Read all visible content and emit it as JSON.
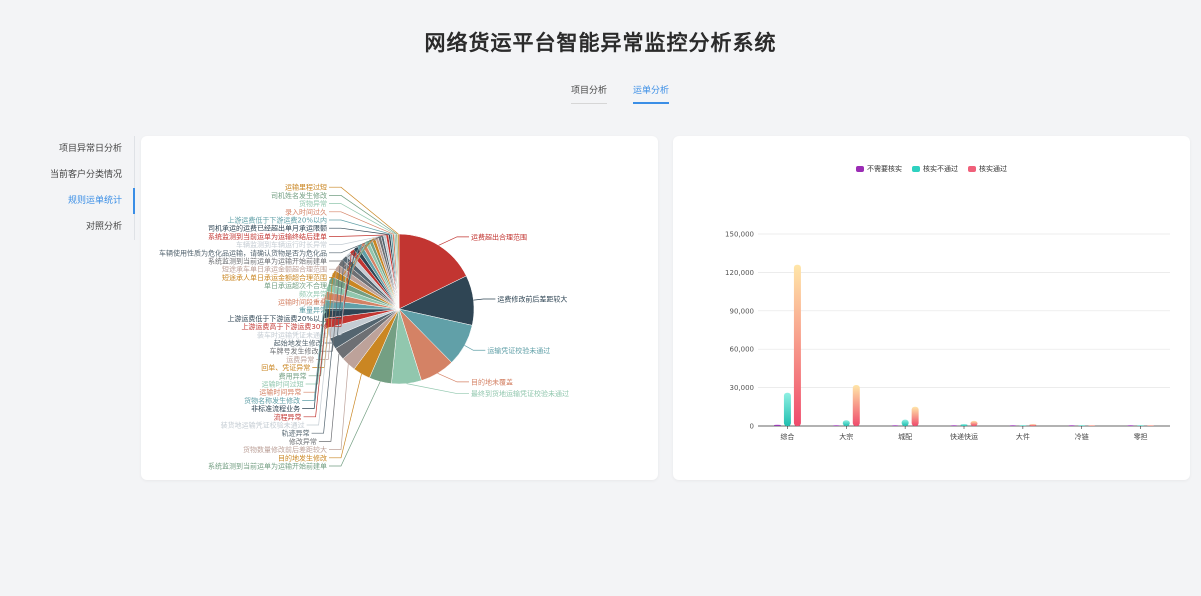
{
  "header": {
    "title": "网络货运平台智能异常监控分析系统"
  },
  "tabs": [
    {
      "label": "项目分析",
      "active": false
    },
    {
      "label": "运单分析",
      "active": true
    }
  ],
  "sidebar": {
    "items": [
      {
        "label": "项目异常日分析",
        "active": false
      },
      {
        "label": "当前客户分类情况",
        "active": false
      },
      {
        "label": "规则运单统计",
        "active": true
      },
      {
        "label": "对照分析",
        "active": false
      }
    ]
  },
  "colors": {
    "accent": "#3a8ee6"
  },
  "chart_data": [
    {
      "type": "pie",
      "slices": [
        {
          "label": "运费超出合理范围",
          "value": 16.5,
          "color": "#c23531"
        },
        {
          "label": "运费修改前后差距较大",
          "value": 10,
          "color": "#2f4554"
        },
        {
          "label": "运输凭证校验未通过",
          "value": 8.5,
          "color": "#61a0a8"
        },
        {
          "label": "目的地未覆盖",
          "value": 7,
          "color": "#d48265"
        },
        {
          "label": "最终到货地运输凭证校验未通过",
          "value": 6,
          "color": "#91c7ae"
        },
        {
          "label": "系统监测到当前运单为运输开始前建单",
          "value": 4.5,
          "color": "#749f83"
        },
        {
          "label": "目的地发生修改",
          "value": 3.5,
          "color": "#ca8622"
        },
        {
          "label": "货物数量修改前后差距较大",
          "value": 3,
          "color": "#bda29a"
        },
        {
          "label": "修改异常",
          "value": 2.5,
          "color": "#6e7074"
        },
        {
          "label": "轨迹异常",
          "value": 2.3,
          "color": "#546570"
        },
        {
          "label": "装货地运输凭证校验未通过",
          "value": 2.1,
          "color": "#c4ccd3"
        },
        {
          "label": "流程异常",
          "value": 2,
          "color": "#c23531"
        },
        {
          "label": "非标准流程业务",
          "value": 1.9,
          "color": "#2f4554"
        },
        {
          "label": "货物名称发生修改",
          "value": 1.8,
          "color": "#61a0a8"
        },
        {
          "label": "运输时间异常",
          "value": 1.7,
          "color": "#d48265"
        },
        {
          "label": "运输时间过短",
          "value": 1.6,
          "color": "#91c7ae"
        },
        {
          "label": "费用异常",
          "value": 1.5,
          "color": "#749f83"
        },
        {
          "label": "回单、凭证异常",
          "value": 1.4,
          "color": "#ca8622"
        },
        {
          "label": "运费异常",
          "value": 1.3,
          "color": "#bda29a"
        },
        {
          "label": "车牌号发生修改",
          "value": 1.2,
          "color": "#6e7074"
        },
        {
          "label": "起始地发生修改",
          "value": 1.1,
          "color": "#546570"
        },
        {
          "label": "装车时运输凭证未通过",
          "value": 1.0,
          "color": "#c4ccd3"
        },
        {
          "label": "上游运费高于下游运费30%",
          "value": 1.0,
          "color": "#c23531"
        },
        {
          "label": "上游运费低于下游运费20%以上",
          "value": 0.9,
          "color": "#2f4554"
        },
        {
          "label": "重量异常",
          "value": 0.9,
          "color": "#61a0a8"
        },
        {
          "label": "运输时间段重叠",
          "value": 0.8,
          "color": "#d48265"
        },
        {
          "label": "频次异常",
          "value": 0.8,
          "color": "#91c7ae"
        },
        {
          "label": "单日承运超次不合理",
          "value": 0.7,
          "color": "#749f83"
        },
        {
          "label": "短途承人单日承运金额超合理范围",
          "value": 0.7,
          "color": "#ca8622"
        },
        {
          "label": "短途承车单日承运金额超合理范围",
          "value": 0.6,
          "color": "#bda29a"
        },
        {
          "label": "系统监测到当前运单为运输开始前建单",
          "value": 0.6,
          "color": "#6e7074"
        },
        {
          "label": "车辆使用性质为危化品运输，请确认货物是否为危化品",
          "value": 0.5,
          "color": "#546570"
        },
        {
          "label": "车辆监测到车辆运行时长异常",
          "value": 0.5,
          "color": "#c4ccd3"
        },
        {
          "label": "系统监测到当前运单为运输终结后建单",
          "value": 0.5,
          "color": "#c23531"
        },
        {
          "label": "司机承运的运费已经超出单月承运限额",
          "value": 0.4,
          "color": "#2f4554"
        },
        {
          "label": "上游运费低于下游运费20%以内",
          "value": 0.4,
          "color": "#61a0a8"
        },
        {
          "label": "录入时间过久",
          "value": 0.4,
          "color": "#d48265"
        },
        {
          "label": "货物异常",
          "value": 0.3,
          "color": "#91c7ae"
        },
        {
          "label": "司机姓名发生修改",
          "value": 0.3,
          "color": "#749f83"
        },
        {
          "label": "运输里程过短",
          "value": 0.3,
          "color": "#ca8622"
        }
      ]
    },
    {
      "type": "bar",
      "categories": [
        "综合",
        "大宗",
        "城配",
        "快递快运",
        "大件",
        "冷链",
        "零担"
      ],
      "series": [
        {
          "name": "不需要核实",
          "color": "#9b2cb5",
          "values": [
            1000,
            300,
            150,
            80,
            40,
            10,
            10
          ]
        },
        {
          "name": "核实不通过",
          "color": "#2ed1c0",
          "values": [
            26000,
            4500,
            5000,
            1500,
            600,
            200,
            100
          ]
        },
        {
          "name": "核实通过",
          "color": "#f0607a",
          "values": [
            126000,
            32000,
            15000,
            4000,
            1500,
            400,
            200
          ]
        }
      ],
      "ylim": [
        0,
        150000
      ],
      "yticks": [
        "0",
        "30,000",
        "60,000",
        "90,000",
        "120,000",
        "150,000"
      ],
      "grid": true,
      "legend_position": "top"
    }
  ]
}
